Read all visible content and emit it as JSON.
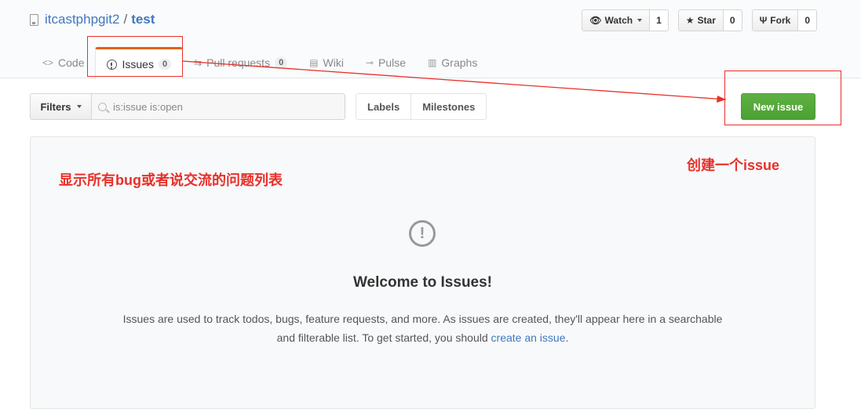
{
  "repo": {
    "owner": "itcastphpgit2",
    "separator": "/",
    "name": "test"
  },
  "actions": [
    {
      "label": "Watch",
      "count": "1"
    },
    {
      "label": "Star",
      "count": "0"
    },
    {
      "label": "Fork",
      "count": "0"
    }
  ],
  "nav": [
    {
      "label": "Code"
    },
    {
      "label": "Issues",
      "count": "0"
    },
    {
      "label": "Pull requests",
      "count": "0"
    },
    {
      "label": "Wiki"
    },
    {
      "label": "Pulse"
    },
    {
      "label": "Graphs"
    }
  ],
  "subnav": {
    "filters_label": "Filters",
    "search_value": "is:issue is:open",
    "labels_label": "Labels",
    "milestones_label": "Milestones",
    "new_issue_label": "New issue"
  },
  "blankslate": {
    "title": "Welcome to Issues!",
    "desc_line1": "Issues are used to track todos, bugs, feature requests, and more. As issues are created, they'll appear here in a searchable",
    "desc_line2_prefix": "and filterable list. To get started, you should ",
    "desc_link": "create an issue",
    "desc_line2_suffix": "."
  },
  "annotations": {
    "list_note": "显示所有bug或者说交流的问题列表",
    "create_note": "创建一个issue",
    "color": "#e8302a"
  }
}
